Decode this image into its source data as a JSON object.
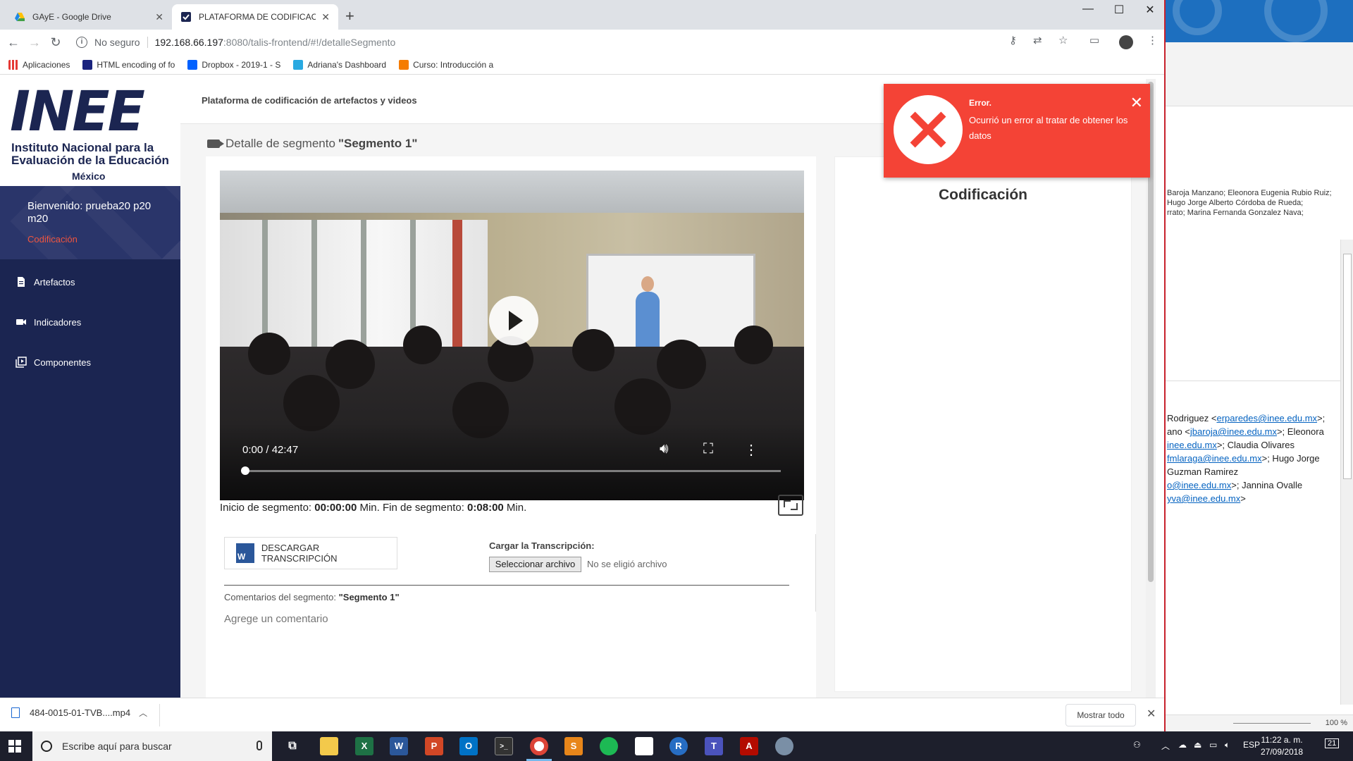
{
  "browser": {
    "tabs": [
      {
        "label": "GAyE - Google Drive",
        "favicon": "google-drive-icon"
      },
      {
        "label": "PLATAFORMA DE CODIFICACIÓN",
        "favicon": "inee-tab-icon"
      }
    ],
    "security_label": "No seguro",
    "url_host": "192.168.66.197",
    "url_rest": ":8080/talis-frontend/#!/detalleSegmento",
    "bookmarks": [
      {
        "label": "Aplicaciones",
        "icon": "apps-grid-icon"
      },
      {
        "label": "HTML encoding of fo",
        "icon": "html-encoding-icon"
      },
      {
        "label": "Dropbox - 2019-1 - S",
        "icon": "dropbox-icon"
      },
      {
        "label": "Adriana's Dashboard",
        "icon": "dashboard-icon"
      },
      {
        "label": "Curso: Introducción a",
        "icon": "course-icon"
      }
    ]
  },
  "sidebar": {
    "logo": {
      "big": "INEE",
      "line1": "Instituto Nacional para la",
      "line2": "Evaluación de la Educación",
      "line3": "México"
    },
    "welcome": "Bienvenido: prueba20 p20 m20",
    "role": "Codificación",
    "items": [
      {
        "label": "Artefactos",
        "icon": "document-icon"
      },
      {
        "label": "Indicadores",
        "icon": "video-camera-icon"
      },
      {
        "label": "Componentes",
        "icon": "library-icon"
      }
    ]
  },
  "header": {
    "platform_title": "Plataforma de codificación de artefactos y videos"
  },
  "segment": {
    "title_prefix": "Detalle de segmento",
    "title_name": "\"Segmento 1\"",
    "video_time": "0:00 / 42:47",
    "video_progress": 0.0,
    "start_label": "Inicio de segmento:",
    "start_value": "00:00:00",
    "min_label_1": "Min. Fin de segmento:",
    "end_value": "0:08:00",
    "min_label_2": "Min.",
    "download_label": "DESCARGAR TRANSCRIPCIÓN",
    "upload_label": "Cargar la Transcripción:",
    "file_button": "Seleccionar archivo",
    "file_status": "No se eligió archivo",
    "comments_label": "Comentarios del segmento:",
    "comments_segment": "\"Segmento 1\"",
    "comment_placeholder": "Agrege un comentario"
  },
  "coding": {
    "title": "Codificación"
  },
  "toast": {
    "title": "Error.",
    "message": "Ocurrió un error al tratar de obtener los datos",
    "color": "#f44336"
  },
  "download_shelf": {
    "file": "484-0015-01-TVB....mp4",
    "show_all": "Mostrar todo"
  },
  "bg_app": {
    "names_line1": "Baroja Manzano;  Eleonora Eugenia Rubio Ruiz;",
    "names_line2": "Hugo Jorge Alberto Córdoba de Rueda;",
    "names_line3": "rrato;  Marina Fernanda Gonzalez Nava;",
    "mail": [
      {
        "pre": "Rodriguez <",
        "link": "erparedes@inee.edu.mx",
        "post": ">;"
      },
      {
        "pre": "ano <",
        "link": "jbaroja@inee.edu.mx",
        "post": ">; Eleonora"
      },
      {
        "pre": "",
        "link": "inee.edu.mx",
        "post": ">; Claudia Olivares"
      },
      {
        "pre": "",
        "link": "fmlaraga@inee.edu.mx",
        "post": ">; Hugo Jorge"
      },
      {
        "pre": "Guzman Ramirez",
        "link": "",
        "post": ""
      },
      {
        "pre": "",
        "link": "o@inee.edu.mx",
        "post": ">; Jannina Ovalle"
      },
      {
        "pre": "",
        "link": "yva@inee.edu.mx",
        "post": ">"
      }
    ],
    "zoom": "100 %"
  },
  "taskbar": {
    "search_placeholder": "Escribe aquí para buscar",
    "lang": "ESP",
    "time": "11:22 a. m.",
    "date": "27/09/2018",
    "notifications": "21"
  }
}
